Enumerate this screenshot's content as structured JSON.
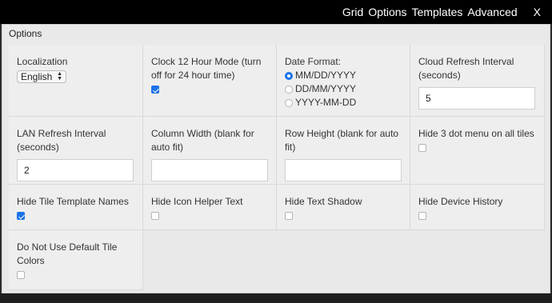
{
  "topnav": {
    "grid": "Grid",
    "options": "Options",
    "templates": "Templates",
    "advanced": "Advanced",
    "close": "X"
  },
  "dialog": {
    "title": "Options",
    "localization": {
      "label": "Localization",
      "value": "English"
    },
    "clock": {
      "label": "Clock 12 Hour Mode (turn off for 24 hour time)",
      "checked": true
    },
    "date_format": {
      "label": "Date Format:",
      "options": [
        "MM/DD/YYYY",
        "DD/MM/YYYY",
        "YYYY-MM-DD"
      ],
      "selected": "MM/DD/YYYY"
    },
    "cloud_refresh": {
      "label": "Cloud Refresh Interval (seconds)",
      "value": "5"
    },
    "lan_refresh": {
      "label": "LAN Refresh Interval (seconds)",
      "value": "2"
    },
    "column_width": {
      "label": "Column Width (blank for auto fit)",
      "value": ""
    },
    "row_height": {
      "label": "Row Height (blank for auto fit)",
      "value": ""
    },
    "hide_3dot": {
      "label": "Hide 3 dot menu on all tiles",
      "checked": false
    },
    "hide_template_names": {
      "label": "Hide Tile Template Names",
      "checked": true
    },
    "hide_icon_helper": {
      "label": "Hide Icon Helper Text",
      "checked": false
    },
    "hide_text_shadow": {
      "label": "Hide Text Shadow",
      "checked": false
    },
    "hide_device_history": {
      "label": "Hide Device History",
      "checked": false
    },
    "no_default_colors": {
      "label": "Do Not Use Default Tile Colors",
      "checked": false
    }
  },
  "colors": {
    "accent": "#1a73e8",
    "topbar": "#000000",
    "dialog_bg": "#e9e9e9"
  }
}
